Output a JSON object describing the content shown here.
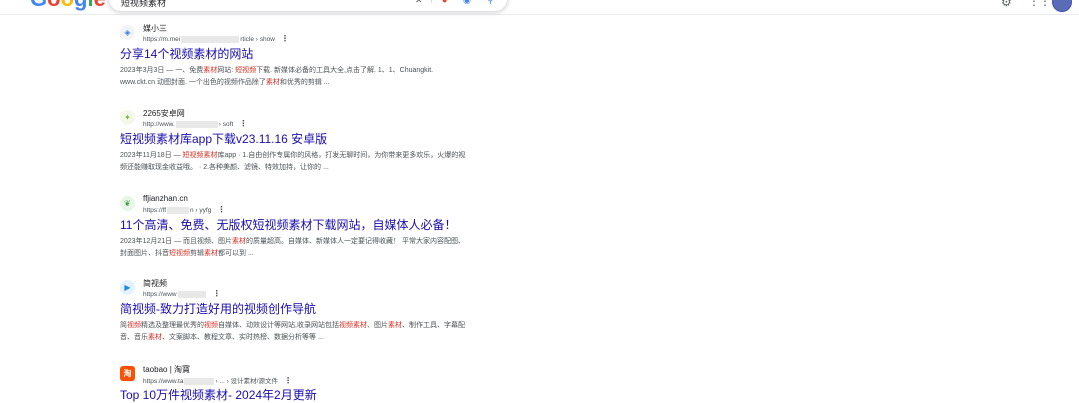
{
  "header": {
    "logo_letters": [
      "G",
      "o",
      "o",
      "g",
      "l",
      "e"
    ],
    "query": "短视频素材",
    "icons": {
      "clear": "close-icon",
      "mic": "microphone-icon",
      "lens": "google-lens-icon",
      "search": "search-icon",
      "settings": "gear-icon",
      "apps": "apps-grid-icon"
    }
  },
  "results": [
    {
      "site_name": "媒小三",
      "url_prefix": "https://m.mei",
      "url_suffix": "rticle › show",
      "title": "分享14个视频素材的网站",
      "snippet_parts": [
        {
          "t": "2023年3月3日 — 一、免费",
          "h": false
        },
        {
          "t": "素材",
          "h": true
        },
        {
          "t": "网站: ",
          "h": false
        },
        {
          "t": "短视频",
          "h": true
        },
        {
          "t": "下载. 新媒体必备的工具大全,点击了解. 1、1、Chuangkit. www.ckt.cn 动图封面. 一个出色的视频作品除了",
          "h": false
        },
        {
          "t": "素材",
          "h": true
        },
        {
          "t": "和优秀的剪辑 ...",
          "h": false
        }
      ]
    },
    {
      "site_name": "2265安卓网",
      "url_prefix": "http://www.",
      "url_suffix": "› soft",
      "title": "短视频素材库app下载v23.11.16 安卓版",
      "snippet_parts": [
        {
          "t": "2023年11月18日 — ",
          "h": false
        },
        {
          "t": "短视频素材",
          "h": true
        },
        {
          "t": "库app · 1.自由创作专属你的风格，打发无聊时间，为你带来更多欢乐，火爆的视频还能赚取现金收益哦。 · 2.各种美颜、滤镜、特效加持，让你的 ...",
          "h": false
        }
      ]
    },
    {
      "site_name": "ffjianzhan.cn",
      "url_prefix": "https://ff",
      "url_suffix": "n › yyfg",
      "title": "11个高清、免费、无版权短视频素材下载网站，自媒体人必备！",
      "snippet_parts": [
        {
          "t": "2023年12月21日 — 而且视频、图片",
          "h": false
        },
        {
          "t": "素材",
          "h": true
        },
        {
          "t": "的质量超高。自媒体、新媒体人一定要记得收藏！ 平常大家内容配图、封面图片、抖音",
          "h": false
        },
        {
          "t": "短视频",
          "h": true
        },
        {
          "t": "剪辑",
          "h": false
        },
        {
          "t": "素材",
          "h": true
        },
        {
          "t": "都可以到 ...",
          "h": false
        }
      ]
    },
    {
      "site_name": "简视频",
      "url_prefix": "https://www",
      "url_suffix": "",
      "title": "简视频-致力打造好用的视频创作导航",
      "snippet_parts": [
        {
          "t": "简",
          "h": false
        },
        {
          "t": "视频",
          "h": true
        },
        {
          "t": "精选及整理最优秀的",
          "h": false
        },
        {
          "t": "视频",
          "h": true
        },
        {
          "t": "自媒体、动效设计等网站,收录网站包括",
          "h": false
        },
        {
          "t": "视频素材",
          "h": true
        },
        {
          "t": "、图片",
          "h": false
        },
        {
          "t": "素材",
          "h": true
        },
        {
          "t": "、制作工具、字幕配音、音乐",
          "h": false
        },
        {
          "t": "素材",
          "h": true
        },
        {
          "t": "、文案脚本、教程文章、实时热榜、数据分析等等 ...",
          "h": false
        }
      ]
    },
    {
      "site_name": "taobao | 淘寶",
      "url_prefix": "https://www.ta",
      "url_suffix": "› ... › 设计素材/源文件",
      "title": "Top 10万件视频素材- 2024年2月更新",
      "snippet_parts": []
    }
  ]
}
